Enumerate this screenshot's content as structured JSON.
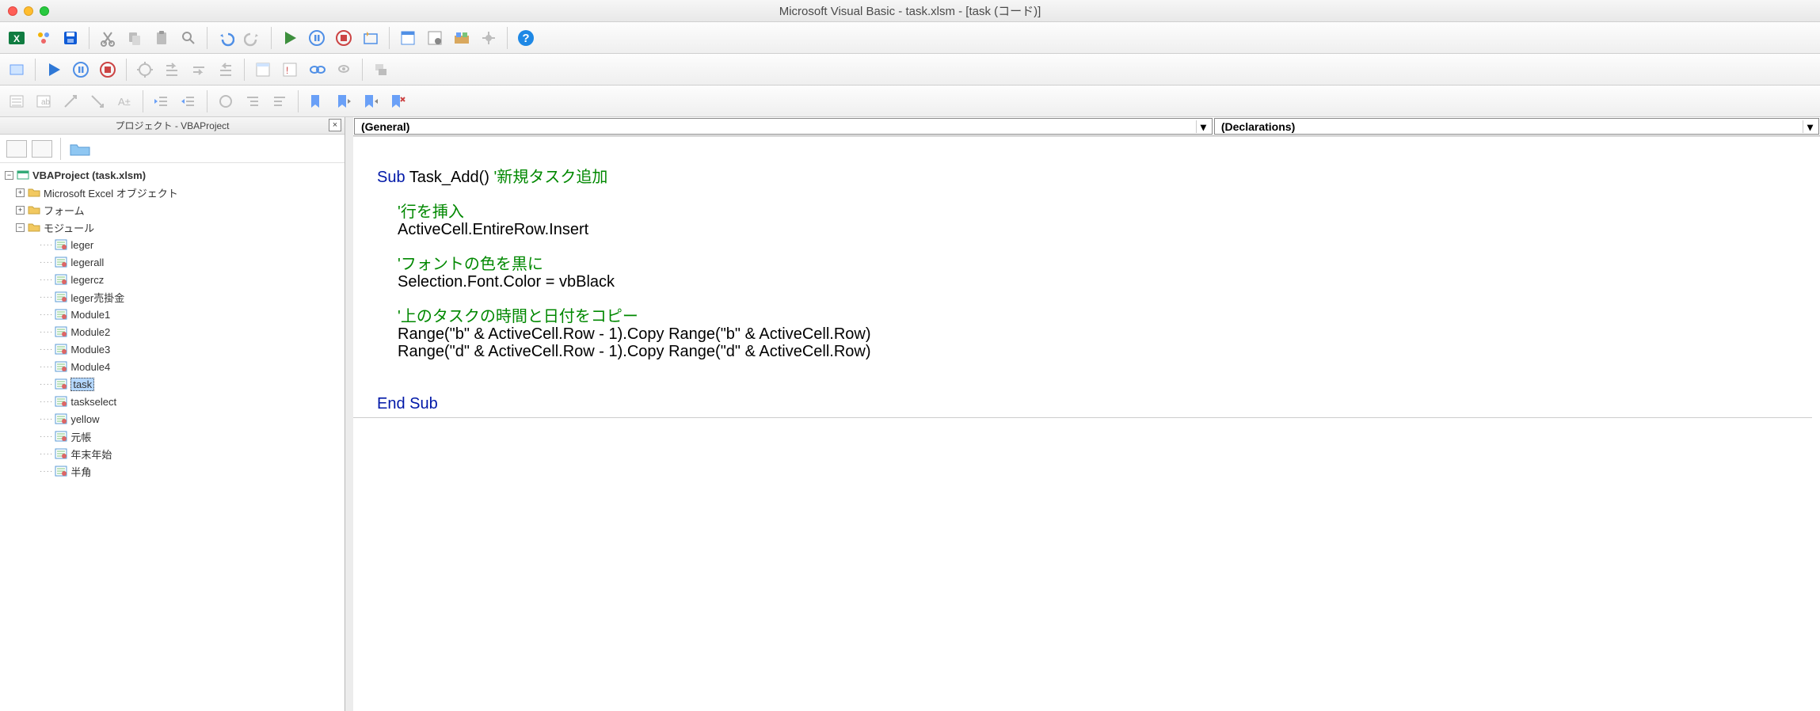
{
  "window": {
    "title": "Microsoft Visual Basic - task.xlsm - [task (コード)]"
  },
  "sidebar": {
    "title": "プロジェクト - VBAProject",
    "root": "VBAProject (task.xlsm)",
    "folders": {
      "excel_objects": "Microsoft Excel オブジェクト",
      "forms": "フォーム",
      "modules": "モジュール"
    },
    "modules": [
      "leger",
      "legerall",
      "legercz",
      "leger売掛金",
      "Module1",
      "Module2",
      "Module3",
      "Module4",
      "task",
      "taskselect",
      "yellow",
      "元帳",
      "年末年始",
      "半角"
    ],
    "selected_module": "task"
  },
  "editor": {
    "combo_left": "(General)",
    "combo_right": "(Declarations)",
    "code": {
      "l1_kw": "Sub ",
      "l1_name": "Task_Add() ",
      "l1_cm": "'新規タスク追加",
      "c1": "'行を挿入",
      "s1": "ActiveCell.EntireRow.Insert",
      "c2": "'フォントの色を黒に",
      "s2": "Selection.Font.Color = vbBlack",
      "c3": "'上のタスクの時間と日付をコピー",
      "s3": "Range(\"b\" & ActiveCell.Row - 1).Copy Range(\"b\" & ActiveCell.Row)",
      "s4": "Range(\"d\" & ActiveCell.Row - 1).Copy Range(\"d\" & ActiveCell.Row)",
      "end": "End Sub"
    }
  }
}
